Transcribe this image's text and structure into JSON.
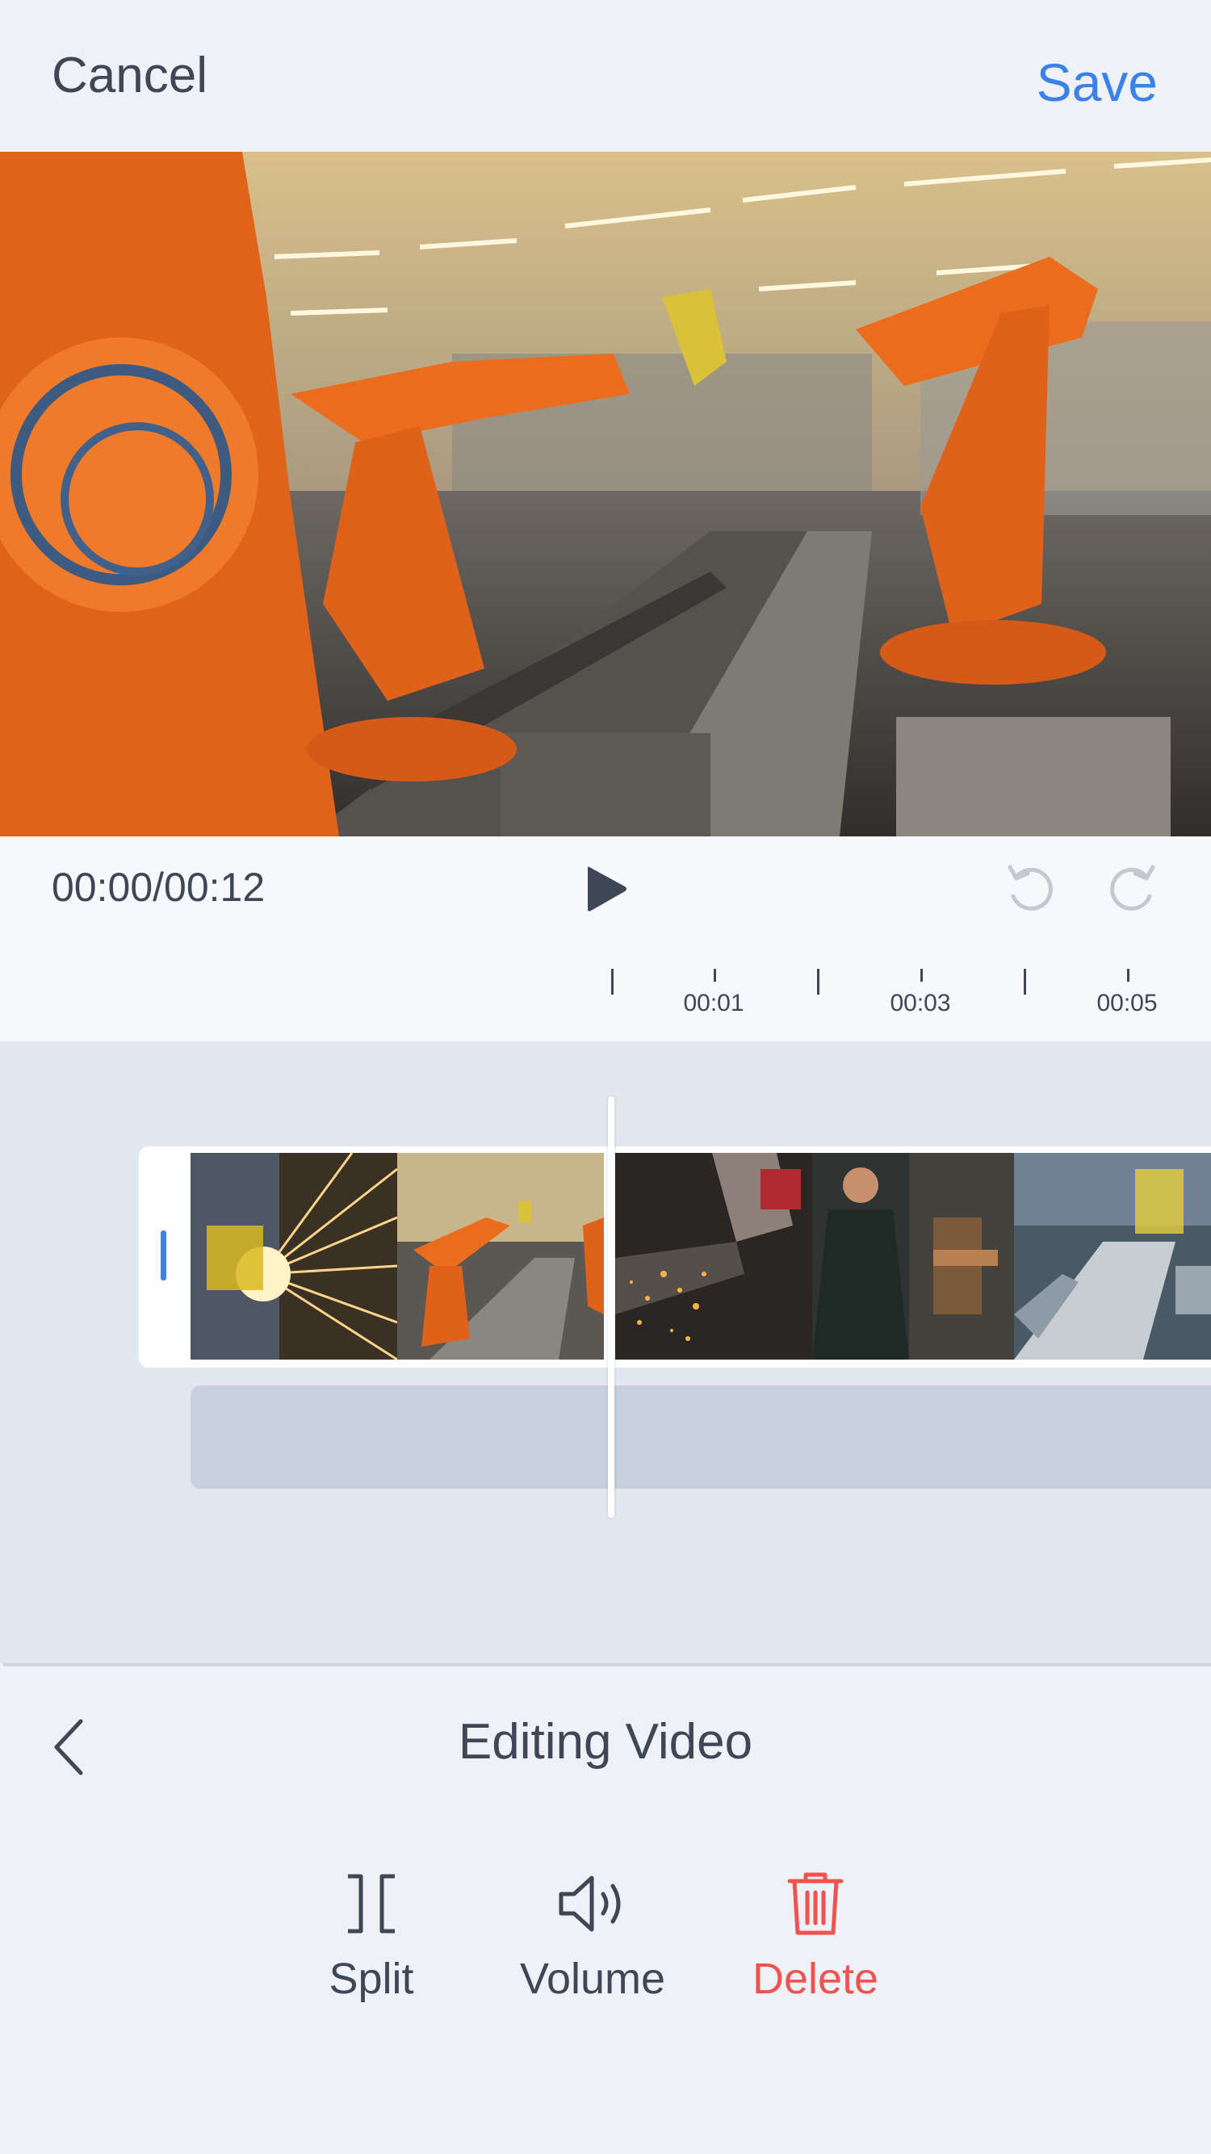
{
  "header": {
    "cancel_label": "Cancel",
    "save_label": "Save"
  },
  "player": {
    "timecode": "00:00/00:12",
    "ruler_labels": [
      "00:01",
      "00:03",
      "00:05"
    ]
  },
  "timeline": {
    "clips": [
      "sparks-grinding",
      "robot-arms-factory",
      "welder-sparks",
      "engineer-machine",
      "assembly-line"
    ]
  },
  "panel": {
    "title": "Editing Video",
    "tools": [
      {
        "label": "Split",
        "icon": "split-icon"
      },
      {
        "label": "Volume",
        "icon": "volume-icon"
      },
      {
        "label": "Delete",
        "icon": "trash-icon"
      }
    ]
  },
  "colors": {
    "accent": "#3b82e8",
    "danger": "#ef5350",
    "text": "#3f4656"
  }
}
